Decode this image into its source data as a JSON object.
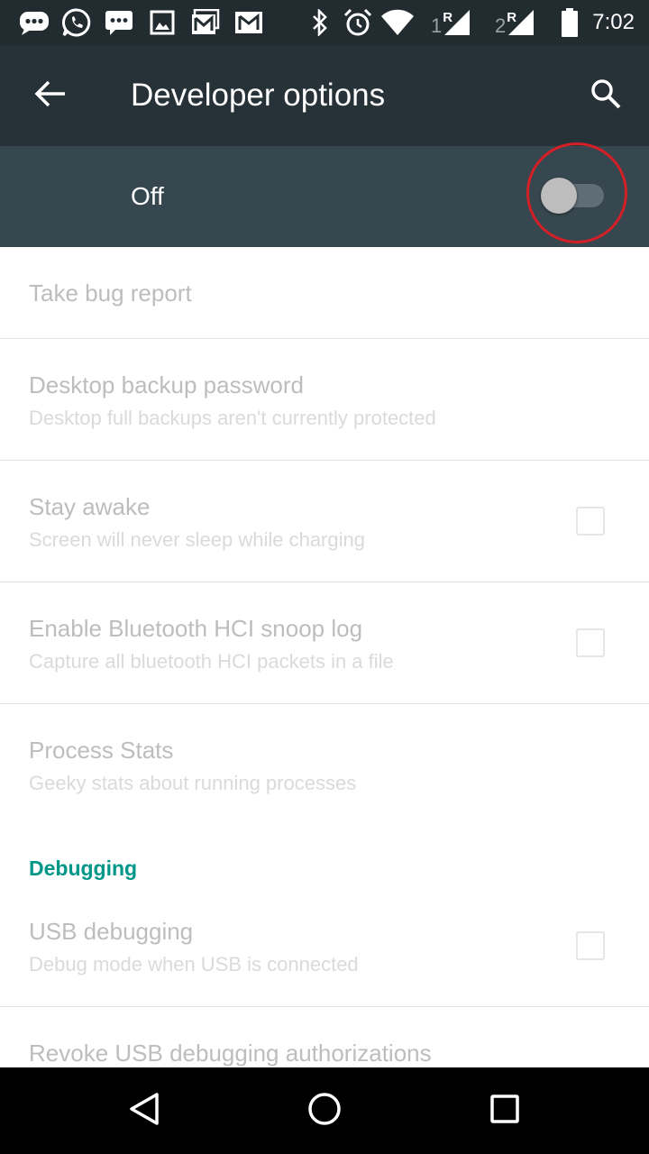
{
  "status_bar": {
    "time": "7:02",
    "sim1_label": "1",
    "sim1_roaming": "R",
    "sim2_label": "2",
    "sim2_roaming": "R",
    "icons": [
      "chat-bubble-icon",
      "whatsapp-icon",
      "sms-icon",
      "gallery-icon",
      "gmail-icon",
      "gmail-icon",
      "bluetooth-icon",
      "alarm-icon",
      "wifi-icon",
      "signal-icon",
      "signal-icon",
      "battery-icon"
    ]
  },
  "app_bar": {
    "title": "Developer options",
    "back_icon": "arrow-back-icon",
    "search_icon": "search-icon"
  },
  "master_switch": {
    "label": "Off",
    "checked": false
  },
  "settings": [
    {
      "title": "Take bug report"
    },
    {
      "title": "Desktop backup password",
      "summary": "Desktop full backups aren't currently protected"
    },
    {
      "title": "Stay awake",
      "summary": "Screen will never sleep while charging",
      "checked": false
    },
    {
      "title": "Enable Bluetooth HCI snoop log",
      "summary": "Capture all bluetooth HCI packets in a file",
      "checked": false
    },
    {
      "title": "Process Stats",
      "summary": "Geeky stats about running processes"
    }
  ],
  "debugging": {
    "header": "Debugging",
    "items": [
      {
        "title": "USB debugging",
        "summary": "Debug mode when USB is connected",
        "checked": false
      },
      {
        "title": "Revoke USB debugging authorizations"
      }
    ]
  },
  "colors": {
    "status_bar": "#212b30",
    "app_bar": "#263238",
    "master_bar": "#37474f",
    "accent": "#009688",
    "annotation": "#d32027"
  },
  "nav_bar": {
    "icons": [
      "back-triangle-icon",
      "home-circle-icon",
      "recents-square-icon"
    ]
  }
}
